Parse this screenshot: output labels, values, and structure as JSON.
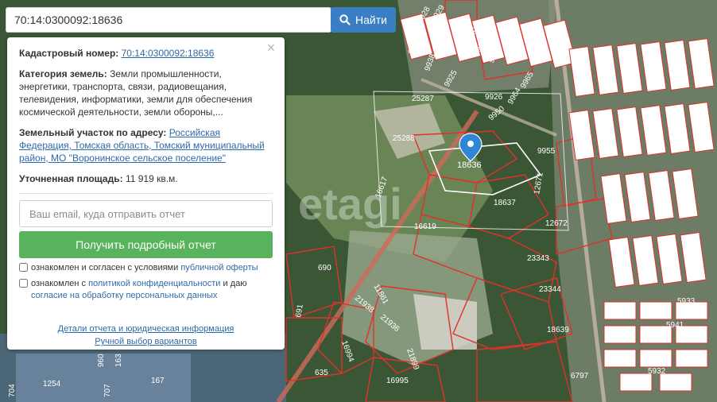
{
  "search": {
    "value": "70:14:0300092:18636",
    "button_label": "Найти",
    "icon": "search-icon"
  },
  "info": {
    "cadastral_label": "Кадастровый номер:",
    "cadastral_value": "70:14:0300092:18636",
    "category_label": "Категория земель:",
    "category_value": "Земли промышленности, энергетики, транспорта, связи, радиовещания, телевидения, информатики, земли для обеспечения космической деятельности, земли обороны,...",
    "address_label": "Земельный участок по адресу:",
    "address_value": "Российская Федерация, Томская область, Томский муниципальный район, МО \"Воронинское сельское поселение\"",
    "area_label": "Уточненная площадь:",
    "area_value": "11 919 кв.м."
  },
  "form": {
    "email_placeholder": "Ваш email, куда отправить отчет",
    "submit_label": "Получить подробный отчет",
    "consent1_text": "ознакомлен и согласен с условиями",
    "consent1_link": "публичной оферты",
    "consent2_text": "ознакомлен с",
    "consent2_link": "политикой конфиденциальности",
    "consent2_mid": "и даю",
    "consent2_link2": "согласие на обработку персональных данных"
  },
  "links": {
    "details": "Детали отчета и юридическая информация",
    "manual": "Ручной выбор вариантов"
  },
  "map": {
    "watermark": "etagi",
    "marker_icon": "map-pin-icon",
    "selected_label": "18636",
    "labels": [
      "25287",
      "25288",
      "16617",
      "16619",
      "18637",
      "12672",
      "12671",
      "23343",
      "23344",
      "18639",
      "11861",
      "21938",
      "21936",
      "21899",
      "16994",
      "16995",
      "690",
      "691",
      "635",
      "1254",
      "960",
      "163",
      "707",
      "704",
      "167",
      "9955",
      "9950",
      "9964",
      "9965",
      "9926",
      "9925",
      "9922",
      "9928",
      "9929",
      "9930",
      "9937",
      "9923",
      "9938",
      "6797",
      "5933",
      "5932",
      "5941"
    ],
    "colors": {
      "parcel_stroke": "#e0312c",
      "highlight": "#ffffff",
      "vegetation": "#35542f",
      "field": "#8aa86b"
    }
  }
}
